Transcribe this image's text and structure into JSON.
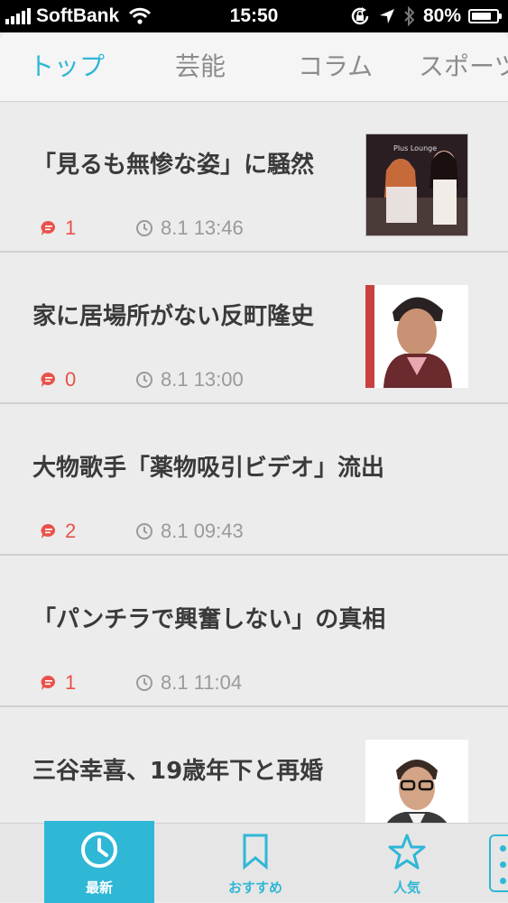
{
  "status_bar": {
    "carrier": "SoftBank",
    "time": "15:50",
    "battery": "80%",
    "battery_level": 0.8
  },
  "tabs": [
    {
      "label": "トップ",
      "active": true
    },
    {
      "label": "芸能",
      "active": false
    },
    {
      "label": "コラム",
      "active": false
    },
    {
      "label": "スポーツ",
      "active": false
    }
  ],
  "articles": [
    {
      "title": "「見るも無惨な姿」に騒然",
      "comments": "1",
      "time": "8.1 13:46",
      "thumb_text": "Plus Lounge"
    },
    {
      "title": "家に居場所がない反町隆史",
      "comments": "0",
      "time": "8.1 13:00"
    },
    {
      "title": "大物歌手「薬物吸引ビデオ」流出",
      "comments": "2",
      "time": "8.1 09:43"
    },
    {
      "title": "「パンチラで興奮しない」の真相",
      "comments": "1",
      "time": "8.1 11:04"
    },
    {
      "title": "三谷幸喜、19歳年下と再婚"
    }
  ],
  "bottom_nav": [
    {
      "label": "最新",
      "icon": "clock-icon",
      "active": true
    },
    {
      "label": "おすすめ",
      "icon": "bookmark-icon",
      "active": false
    },
    {
      "label": "人気",
      "icon": "star-icon",
      "active": false
    }
  ],
  "colors": {
    "accent": "#2fb7d6",
    "comment": "#e8524a",
    "title": "#3a3a3a"
  }
}
